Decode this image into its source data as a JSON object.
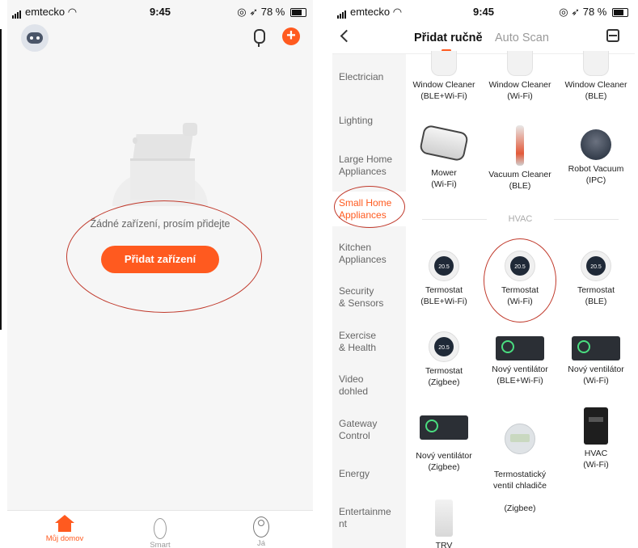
{
  "left": {
    "status": {
      "carrier": "emtecko",
      "time": "9:45",
      "battery": "78 %"
    },
    "empty_text": "Žádné zařízení, prosím přidejte",
    "add_button": "Přidat zařízení",
    "tabs": [
      {
        "label": "Můj domov",
        "icon": "home-icon"
      },
      {
        "label": "Smart",
        "icon": "sun-icon"
      },
      {
        "label": "Já",
        "icon": "user-icon"
      }
    ],
    "accent": "#ff5a1f"
  },
  "right": {
    "status": {
      "carrier": "emtecko",
      "time": "9:45",
      "battery": "78 %"
    },
    "nav": {
      "tab_manual": "Přidat ručně",
      "tab_auto": "Auto Scan"
    },
    "categories": [
      "Electrician",
      "Lighting",
      "Large Home\nAppliances",
      "Small Home\nAppliances",
      "Kitchen\nAppliances",
      "Security\n& Sensors",
      "Exercise\n& Health",
      "Video\ndohled",
      "Gateway\nControl",
      "Energy",
      "Entertainme\nnt"
    ],
    "active_category": "Small Home Appliances",
    "section_hvac": "HVAC",
    "devices": [
      {
        "name": "Window Cleaner",
        "sub": "(BLE+Wi-Fi)",
        "icon": "window-cleaner-icon"
      },
      {
        "name": "Window Cleaner",
        "sub": "(Wi-Fi)",
        "icon": "window-cleaner-icon"
      },
      {
        "name": "Window Cleaner",
        "sub": "(BLE)",
        "icon": "window-cleaner-icon"
      },
      {
        "name": "Mower",
        "sub": "(Wi-Fi)",
        "icon": "mower-icon"
      },
      {
        "name": "Vacuum Cleaner",
        "sub": "(BLE)",
        "icon": "vacuum-cleaner-icon"
      },
      {
        "name": "Robot Vacuum",
        "sub": "(IPC)",
        "icon": "robot-vacuum-icon"
      },
      {
        "name": "Termostat",
        "sub": "(BLE+Wi-Fi)",
        "icon": "thermostat-icon",
        "reading": "20.5"
      },
      {
        "name": "Termostat",
        "sub": "(Wi-Fi)",
        "icon": "thermostat-icon",
        "reading": "20.5"
      },
      {
        "name": "Termostat",
        "sub": "(BLE)",
        "icon": "thermostat-icon",
        "reading": "20.5"
      },
      {
        "name": "Termostat",
        "sub": "(Zigbee)",
        "icon": "thermostat-icon",
        "reading": "20.5"
      },
      {
        "name": "Nový ventilátor",
        "sub": "(BLE+Wi-Fi)",
        "icon": "fan-controller-icon"
      },
      {
        "name": "Nový ventilátor",
        "sub": "(Wi-Fi)",
        "icon": "fan-controller-icon"
      },
      {
        "name": "Nový ventilátor",
        "sub": "(Zigbee)",
        "icon": "fan-controller-icon"
      },
      {
        "name": "Termostatický\nventil chladiče",
        "sub": "(Zigbee)",
        "icon": "radiator-valve-icon"
      },
      {
        "name": "HVAC",
        "sub": "(Wi-Fi)",
        "icon": "hvac-panel-icon"
      },
      {
        "name": "TRV",
        "sub": "",
        "icon": "trv-icon"
      }
    ],
    "accent": "#ff5a1f"
  }
}
